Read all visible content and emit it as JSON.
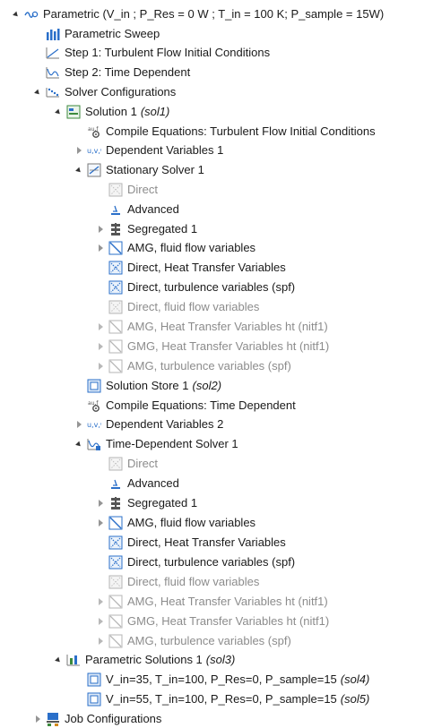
{
  "colors": {
    "text": "#1a1a1a",
    "disabled_text": "#8c8c8c",
    "accent_blue": "#2a6fc9",
    "green": "#3c8a3c"
  },
  "tree": {
    "parametric": {
      "label": "Parametric (V_in ; P_Res = 0 W ; T_in = 100 K; P_sample = 15W)",
      "icon": "parametric-study-icon"
    },
    "parametric_sweep": {
      "label": "Parametric Sweep",
      "icon": "parametric-sweep-icon"
    },
    "step1": {
      "label": "Step 1: Turbulent Flow Initial Conditions",
      "icon": "step-icon"
    },
    "step2": {
      "label": "Step 2: Time Dependent",
      "icon": "time-dependent-step-icon"
    },
    "solver_configurations": {
      "label": "Solver Configurations",
      "icon": "solver-configurations-icon"
    },
    "solution1": {
      "label": "Solution 1",
      "tag": "(sol1)",
      "icon": "solution-icon"
    },
    "compile1": {
      "label": "Compile Equations: Turbulent Flow Initial Conditions",
      "icon": "compile-equations-icon"
    },
    "dep_vars1": {
      "label": "Dependent Variables 1",
      "icon": "dependent-variables-icon"
    },
    "stationary_solver": {
      "label": "Stationary Solver 1",
      "icon": "stationary-solver-icon"
    },
    "s_direct": {
      "label": "Direct",
      "icon": "direct-solver-icon"
    },
    "s_advanced": {
      "label": "Advanced",
      "icon": "advanced-icon"
    },
    "s_segregated": {
      "label": "Segregated 1",
      "icon": "segregated-icon"
    },
    "s_amg_fluid": {
      "label": "AMG, fluid flow variables",
      "icon": "iterative-solver-icon"
    },
    "s_direct_heat": {
      "label": "Direct, Heat Transfer Variables",
      "icon": "direct-solver-icon"
    },
    "s_direct_turb": {
      "label": "Direct, turbulence variables (spf)",
      "icon": "direct-solver-icon"
    },
    "s_direct_fluid": {
      "label": "Direct, fluid flow variables",
      "icon": "direct-solver-icon"
    },
    "s_amg_heat": {
      "label": "AMG, Heat Transfer Variables ht (nitf1)",
      "icon": "iterative-solver-icon"
    },
    "s_gmg_heat": {
      "label": "GMG, Heat Transfer Variables ht (nitf1)",
      "icon": "iterative-solver-icon"
    },
    "s_amg_turb": {
      "label": "AMG, turbulence variables (spf)",
      "icon": "iterative-solver-icon"
    },
    "solution_store": {
      "label": "Solution Store 1",
      "tag": "(sol2)",
      "icon": "solution-store-icon"
    },
    "compile2": {
      "label": "Compile Equations: Time Dependent",
      "icon": "compile-equations-icon"
    },
    "dep_vars2": {
      "label": "Dependent Variables 2",
      "icon": "dependent-variables-icon"
    },
    "time_solver": {
      "label": "Time-Dependent Solver 1",
      "icon": "time-dependent-solver-icon"
    },
    "t_direct": {
      "label": "Direct",
      "icon": "direct-solver-icon"
    },
    "t_advanced": {
      "label": "Advanced",
      "icon": "advanced-icon"
    },
    "t_segregated": {
      "label": "Segregated 1",
      "icon": "segregated-icon"
    },
    "t_amg_fluid": {
      "label": "AMG, fluid flow variables",
      "icon": "iterative-solver-icon"
    },
    "t_direct_heat": {
      "label": "Direct, Heat Transfer Variables",
      "icon": "direct-solver-icon"
    },
    "t_direct_turb": {
      "label": "Direct, turbulence variables (spf)",
      "icon": "direct-solver-icon"
    },
    "t_direct_fluid": {
      "label": "Direct, fluid flow variables",
      "icon": "direct-solver-icon"
    },
    "t_amg_heat": {
      "label": "AMG, Heat Transfer Variables ht (nitf1)",
      "icon": "iterative-solver-icon"
    },
    "t_gmg_heat": {
      "label": "GMG, Heat Transfer Variables ht (nitf1)",
      "icon": "iterative-solver-icon"
    },
    "t_amg_turb": {
      "label": "AMG, turbulence variables (spf)",
      "icon": "iterative-solver-icon"
    },
    "param_solutions": {
      "label": "Parametric Solutions 1",
      "tag": "(sol3)",
      "icon": "parametric-solutions-icon"
    },
    "sol4": {
      "label": "V_in=35, T_in=100, P_Res=0, P_sample=15",
      "tag": "(sol4)",
      "icon": "solution-store-icon"
    },
    "sol5": {
      "label": "V_in=55, T_in=100, P_Res=0, P_sample=15",
      "tag": "(sol5)",
      "icon": "solution-store-icon"
    },
    "job_configurations": {
      "label": "Job Configurations",
      "icon": "job-configurations-icon"
    }
  }
}
